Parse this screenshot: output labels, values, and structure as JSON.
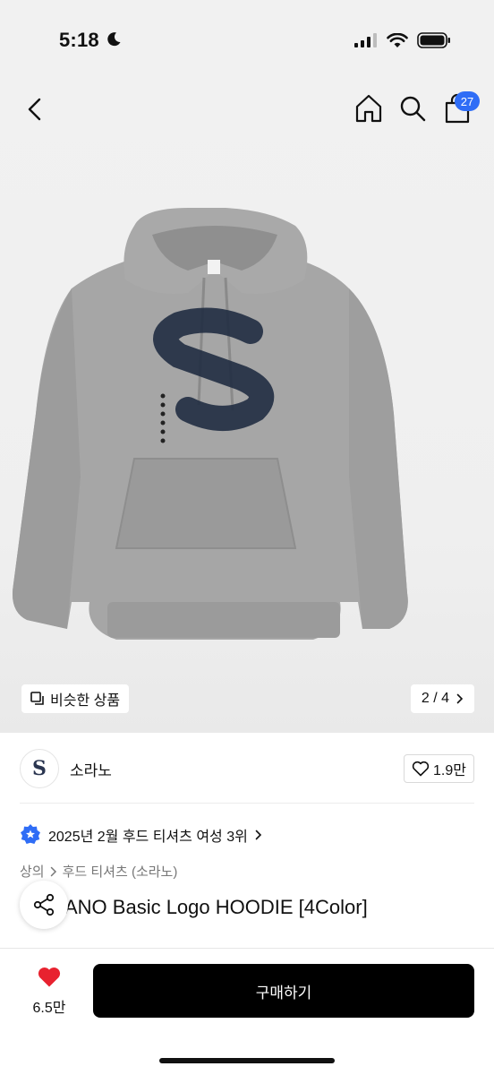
{
  "status": {
    "time": "5:18"
  },
  "header": {
    "cart_count": "27"
  },
  "gallery": {
    "similar_label": "비슷한 상품",
    "page_indicator": "2 / 4"
  },
  "brand": {
    "logo_letter": "S",
    "name": "소라노",
    "likes": "1.9만"
  },
  "ranking": {
    "text": "2025년 2월 후드 티셔츠 여성 3위"
  },
  "breadcrumb": {
    "level1": "상의",
    "level2": "후드 티셔츠 (소라노)"
  },
  "product": {
    "title": "SORANO Basic Logo HOODIE [4Color]",
    "visible_title": "ANO Basic Logo HOODIE [4Color]"
  },
  "bottom": {
    "fav_count": "6.5만",
    "buy_label": "구매하기"
  },
  "colors": {
    "accent_badge": "#2f6df6",
    "heart": "#e8222f",
    "buy_button": "#000000"
  }
}
